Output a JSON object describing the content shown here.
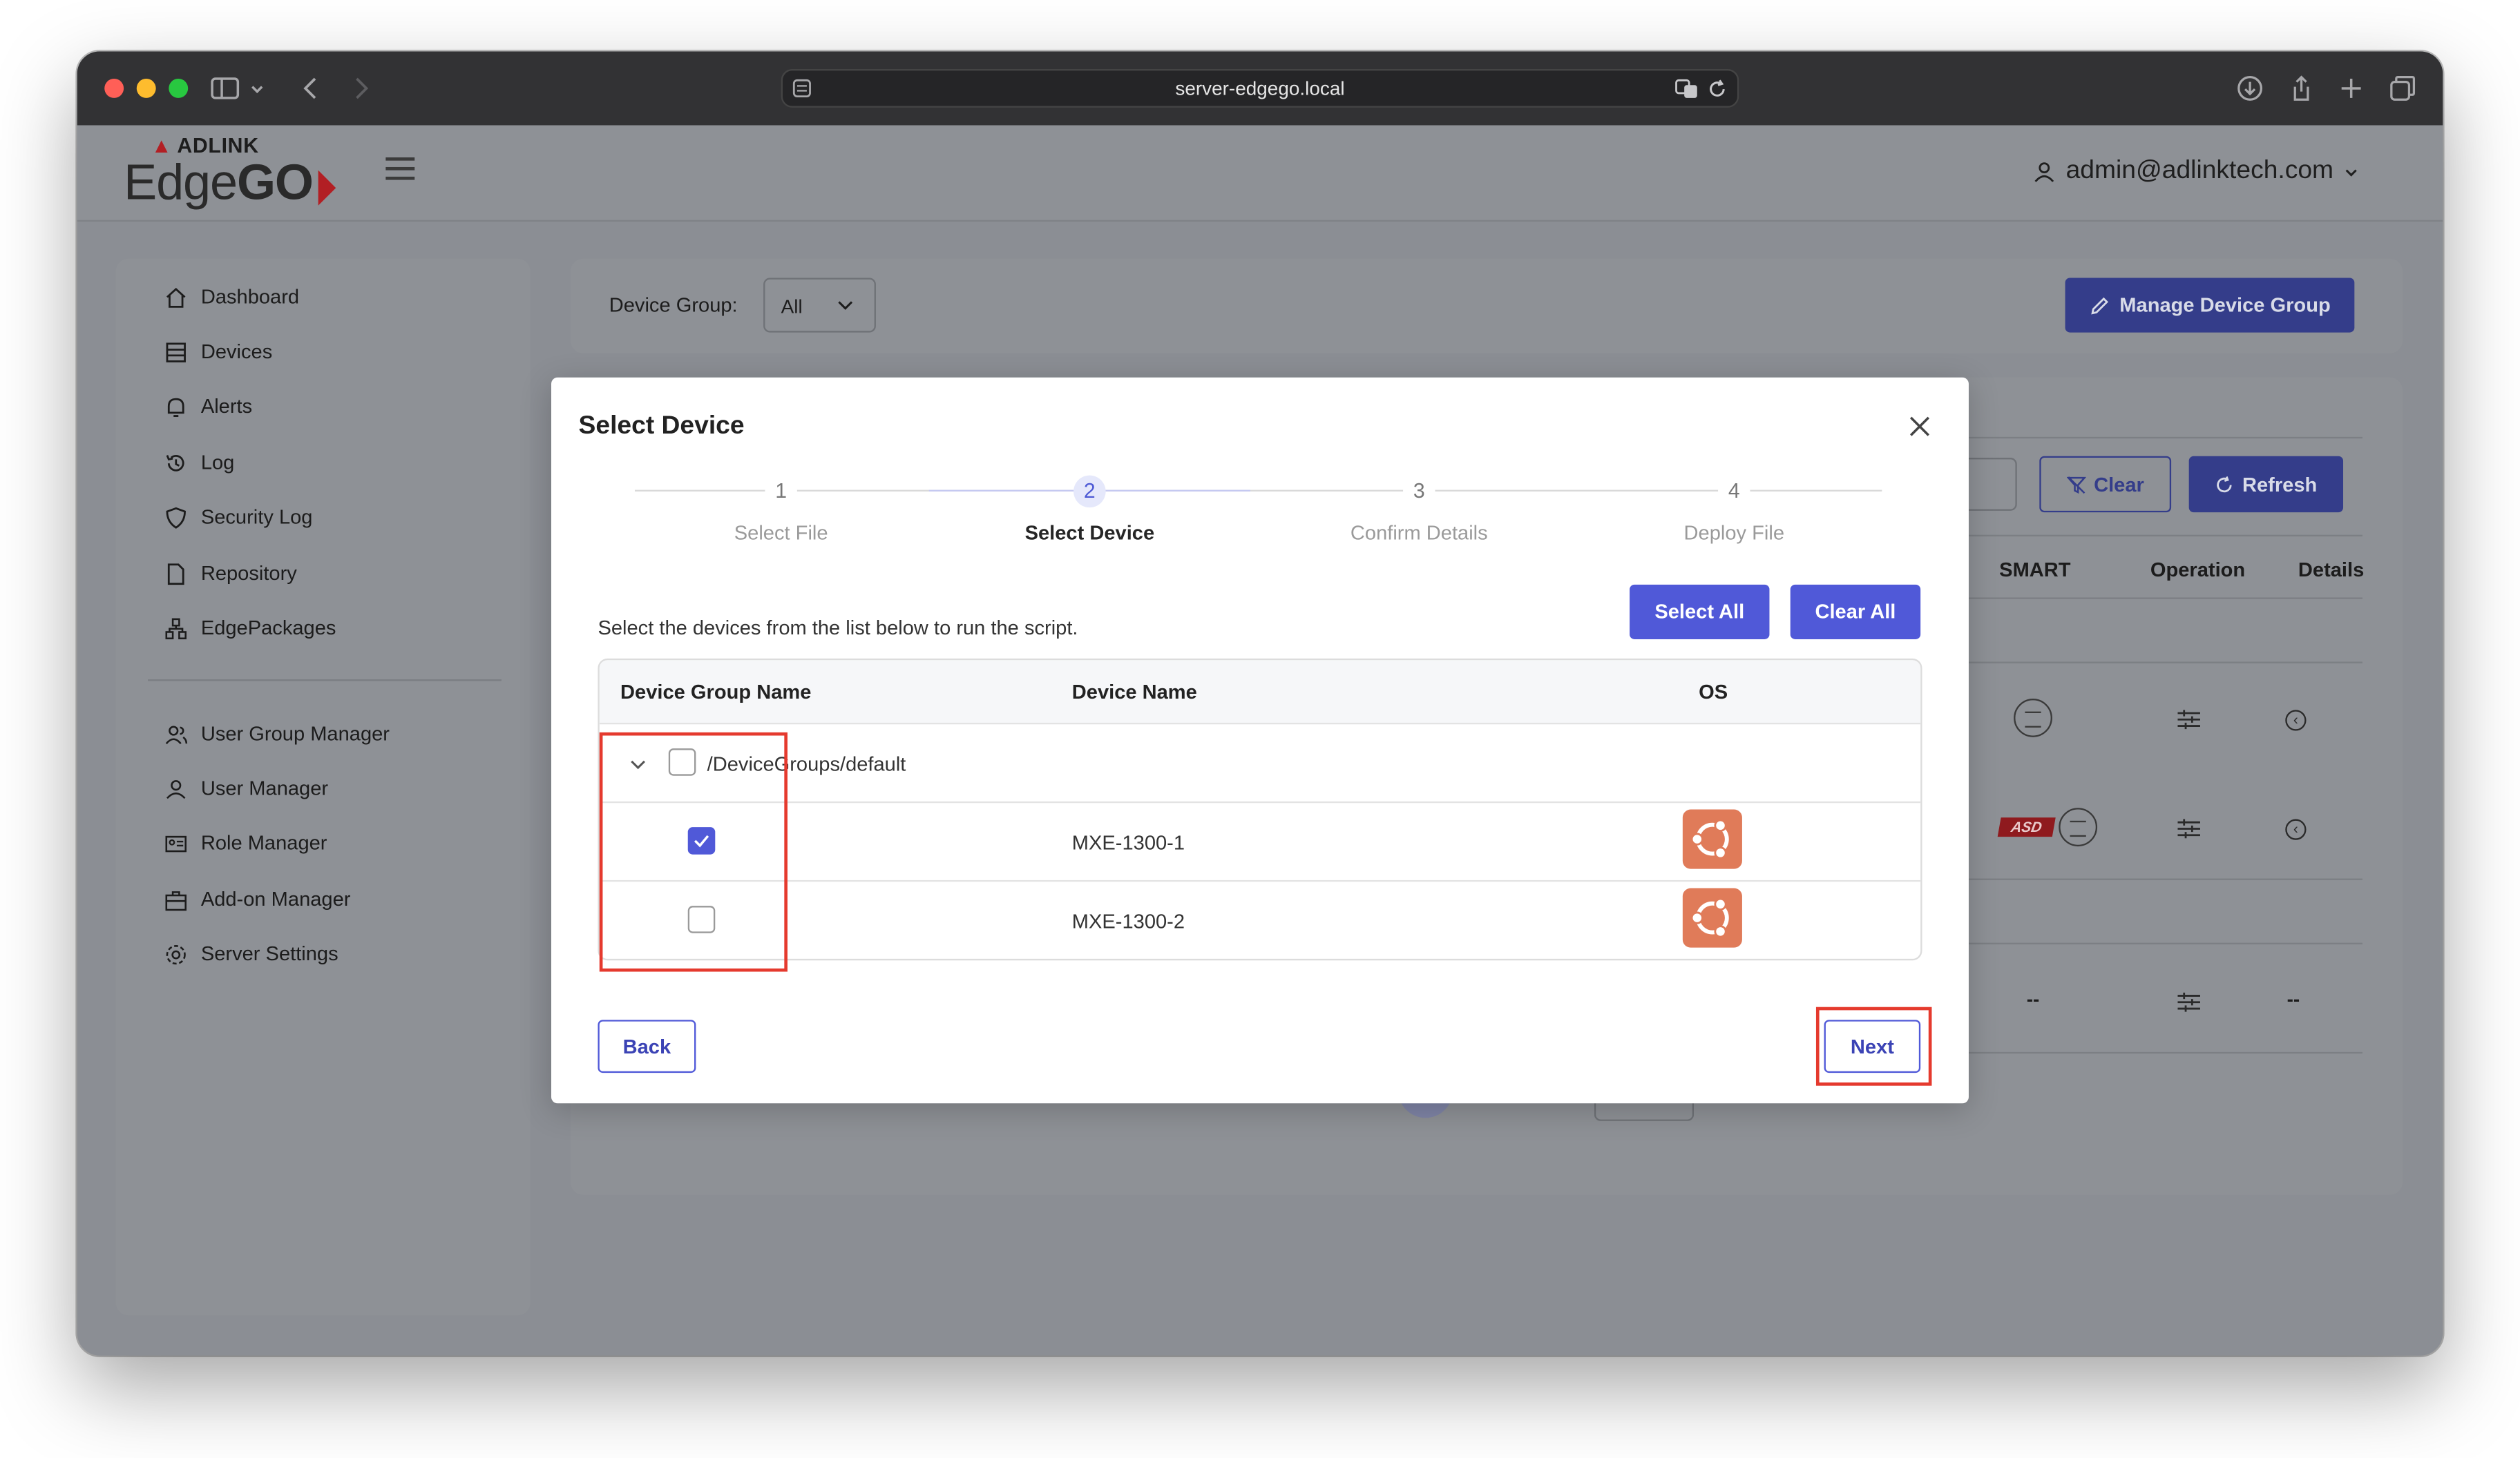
{
  "browser": {
    "url": "server-edgego.local",
    "traffic_lights": [
      "#ff5f57",
      "#febc2e",
      "#28c840"
    ]
  },
  "app": {
    "logo_small": "ADLINK",
    "logo_big_light": "Edge",
    "logo_big_bold": "GO",
    "user_email": "admin@adlinktech.com"
  },
  "sidebar": {
    "items": [
      {
        "label": "Dashboard",
        "icon": "home-icon"
      },
      {
        "label": "Devices",
        "icon": "devices-icon"
      },
      {
        "label": "Alerts",
        "icon": "bell-icon"
      },
      {
        "label": "Log",
        "icon": "history-icon"
      },
      {
        "label": "Security Log",
        "icon": "shield-icon"
      },
      {
        "label": "Repository",
        "icon": "file-icon"
      },
      {
        "label": "EdgePackages",
        "icon": "packages-icon"
      },
      {
        "label": "User Group Manager",
        "icon": "user-group-icon"
      },
      {
        "label": "User Manager",
        "icon": "users-icon"
      },
      {
        "label": "Role Manager",
        "icon": "id-card-icon"
      },
      {
        "label": "Add-on Manager",
        "icon": "briefcase-icon"
      },
      {
        "label": "Server Settings",
        "icon": "gear-icon"
      }
    ]
  },
  "toolbar": {
    "device_group_label": "Device Group:",
    "device_group_value": "All",
    "manage_button": "Manage Device Group"
  },
  "list": {
    "clear_button": "Clear",
    "refresh_button": "Refresh",
    "columns": [
      "SMART",
      "Operation",
      "Details"
    ],
    "empty_value": "--"
  },
  "modal": {
    "title": "Select Device",
    "steps": [
      {
        "number": "1",
        "label": "Select File"
      },
      {
        "number": "2",
        "label": "Select Device"
      },
      {
        "number": "3",
        "label": "Confirm Details"
      },
      {
        "number": "4",
        "label": "Deploy File"
      }
    ],
    "active_step": 2,
    "instruction": "Select the devices from the list below to run the script.",
    "select_all": "Select All",
    "clear_all": "Clear All",
    "table": {
      "headers": [
        "Device Group Name",
        "Device Name",
        "OS"
      ],
      "group": "/DeviceGroups/default",
      "rows": [
        {
          "device": "MXE-1300-1",
          "checked": true
        },
        {
          "device": "MXE-1300-2",
          "checked": false
        }
      ]
    },
    "back_button": "Back",
    "next_button": "Next"
  },
  "colors": {
    "primary": "#5059d8",
    "highlight": "#e53a2e",
    "os_icon": "#e07b59"
  }
}
